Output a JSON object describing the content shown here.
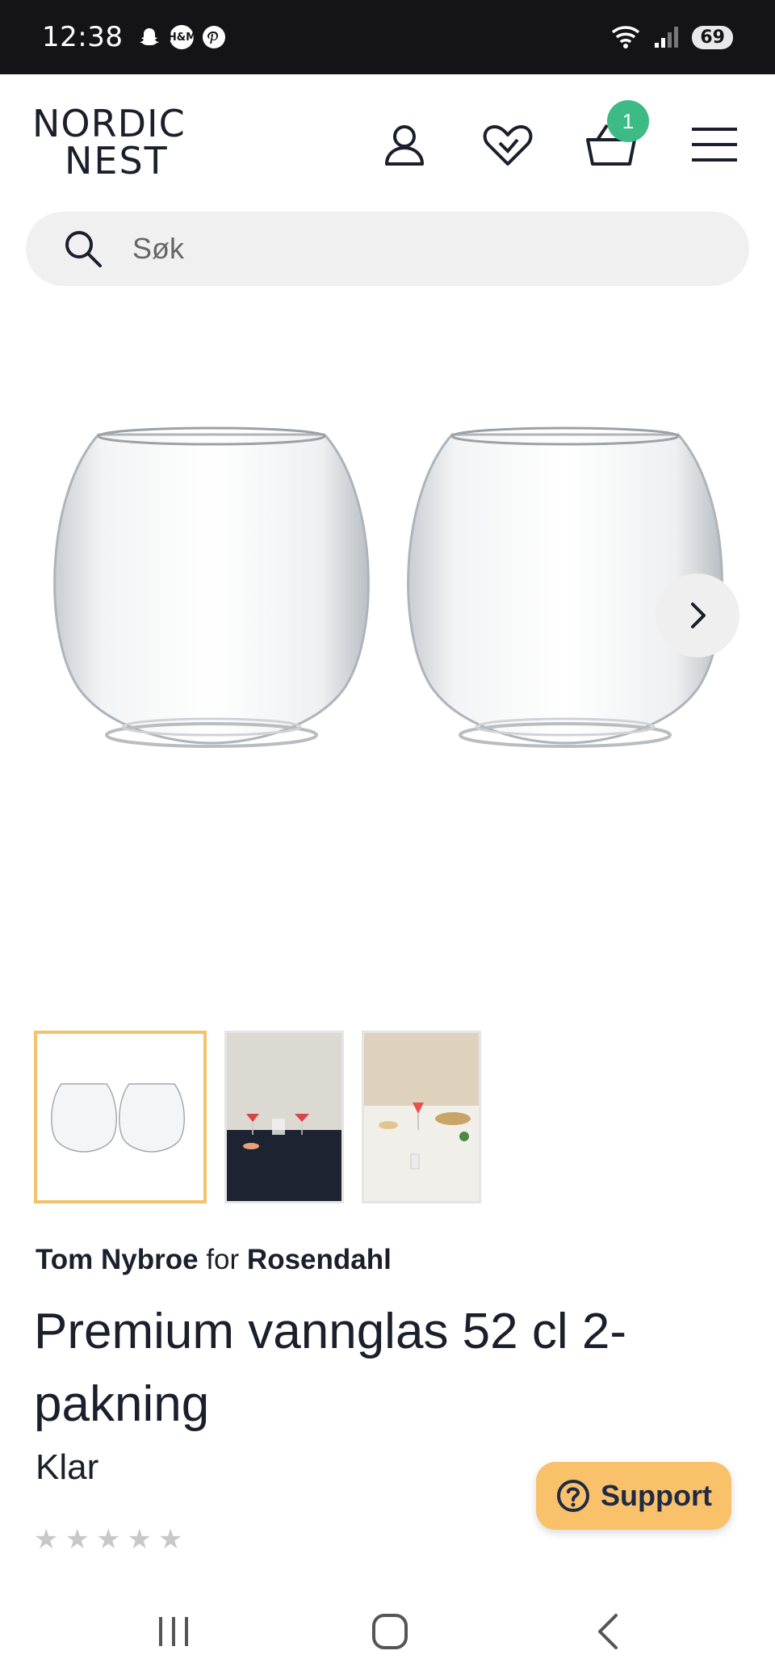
{
  "status_bar": {
    "time": "12:38",
    "notifications": [
      "snapchat-icon",
      "hm-icon",
      "pinterest-icon"
    ],
    "hm_label": "H&M",
    "battery": "69"
  },
  "header": {
    "logo_line1": "NORDIC",
    "logo_line2": "NEST",
    "cart_count": "1"
  },
  "search": {
    "placeholder": "Søk"
  },
  "gallery": {
    "active_thumb_index": 0,
    "thumbnails": [
      "two clear tumblers",
      "red cocktails on dark table",
      "table setting with wine glass"
    ]
  },
  "product": {
    "designer": "Tom Nybroe",
    "connector": "for",
    "brand": "Rosendahl",
    "title": "Premium vannglas 52 cl 2-pakning",
    "variant": "Klar",
    "rating": 0,
    "rating_max": 5
  },
  "support": {
    "label": "Support"
  },
  "colors": {
    "accent_badge": "#3dbb86",
    "support_bg": "#f9c16a",
    "active_thumb_border": "#f3c26a"
  }
}
